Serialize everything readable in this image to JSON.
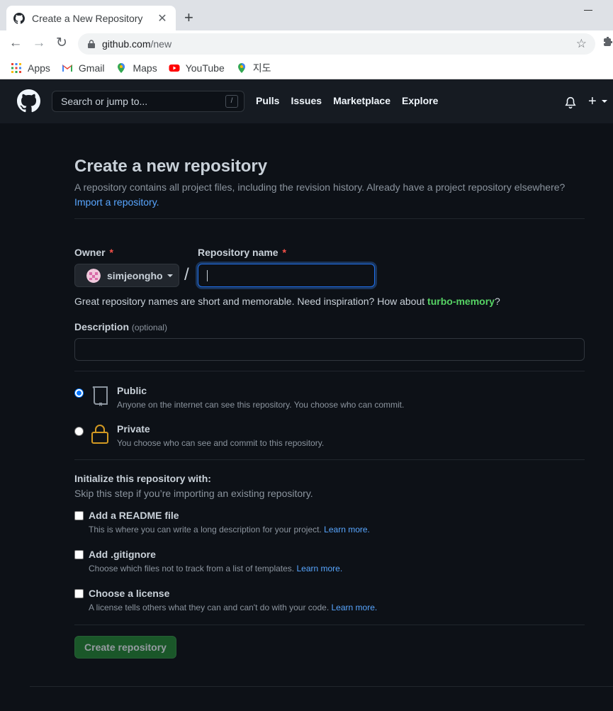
{
  "browser": {
    "tab_title": "Create a New Repository",
    "tab_close": "✕",
    "new_tab": "+",
    "url_domain": "github.com",
    "url_path": "/new",
    "back": "←",
    "forward": "→",
    "reload": "↻",
    "star": "☆",
    "bookmarks": [
      {
        "label": "Apps",
        "icon": "apps-grid-icon"
      },
      {
        "label": "Gmail",
        "icon": "gmail-icon"
      },
      {
        "label": "Maps",
        "icon": "maps-pin-icon"
      },
      {
        "label": "YouTube",
        "icon": "youtube-icon"
      },
      {
        "label": "지도",
        "icon": "maps-pin-icon"
      }
    ]
  },
  "header": {
    "search_placeholder": "Search or jump to...",
    "search_shortcut": "/",
    "nav": [
      "Pulls",
      "Issues",
      "Marketplace",
      "Explore"
    ],
    "plus": "+"
  },
  "page": {
    "title": "Create a new repository",
    "description": "A repository contains all project files, including the revision history. Already have a project repository elsewhere?",
    "import_link": "Import a repository."
  },
  "form": {
    "owner_label": "Owner",
    "required_mark": "*",
    "owner_value": "simjeongho",
    "repo_label": "Repository name",
    "repo_value": "",
    "separator": "/",
    "suggestion_prefix": "Great repository names are short and memorable. Need inspiration? How about ",
    "suggestion_name": "turbo-memory",
    "suggestion_suffix": "?",
    "description_label": "Description",
    "description_optional": "(optional)",
    "description_value": "",
    "visibility": {
      "public_title": "Public",
      "public_desc": "Anyone on the internet can see this repository. You choose who can commit.",
      "private_title": "Private",
      "private_desc": "You choose who can see and commit to this repository.",
      "selected": "Public"
    },
    "init": {
      "title": "Initialize this repository with:",
      "subtitle": "Skip this step if you’re importing an existing repository.",
      "learn_more": "Learn more.",
      "readme_title": "Add a README file",
      "readme_desc": "This is where you can write a long description for your project.",
      "gitignore_title": "Add .gitignore",
      "gitignore_desc": "Choose which files not to track from a list of templates.",
      "license_title": "Choose a license",
      "license_desc": "A license tells others what they can and can't do with your code."
    },
    "submit_label": "Create repository"
  },
  "colors": {
    "background": "#0d1117",
    "header": "#161b22",
    "link": "#58a6ff",
    "suggestion": "#56d364",
    "button": "#238636",
    "required": "#f85149",
    "focus": "#1f6feb"
  }
}
